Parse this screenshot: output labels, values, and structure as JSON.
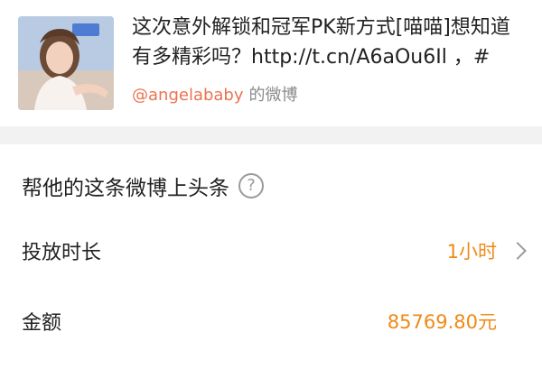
{
  "post": {
    "text": "这次意外解锁和冠军PK新方式[喵喵]想知道有多精彩吗？http://t.cn/A6aOu6Il ，#",
    "author_handle": "@angelababy",
    "author_suffix": "的微博"
  },
  "promo": {
    "title": "帮他的这条微博上头条",
    "help_icon": "question-circle",
    "duration_label": "投放时长",
    "duration_value": "1小时",
    "amount_label": "金额",
    "amount_value": "85769.80元"
  },
  "colors": {
    "accent_orange": "#ef8a16",
    "handle_orange": "#eb7350",
    "background": "#f2f2f2"
  }
}
